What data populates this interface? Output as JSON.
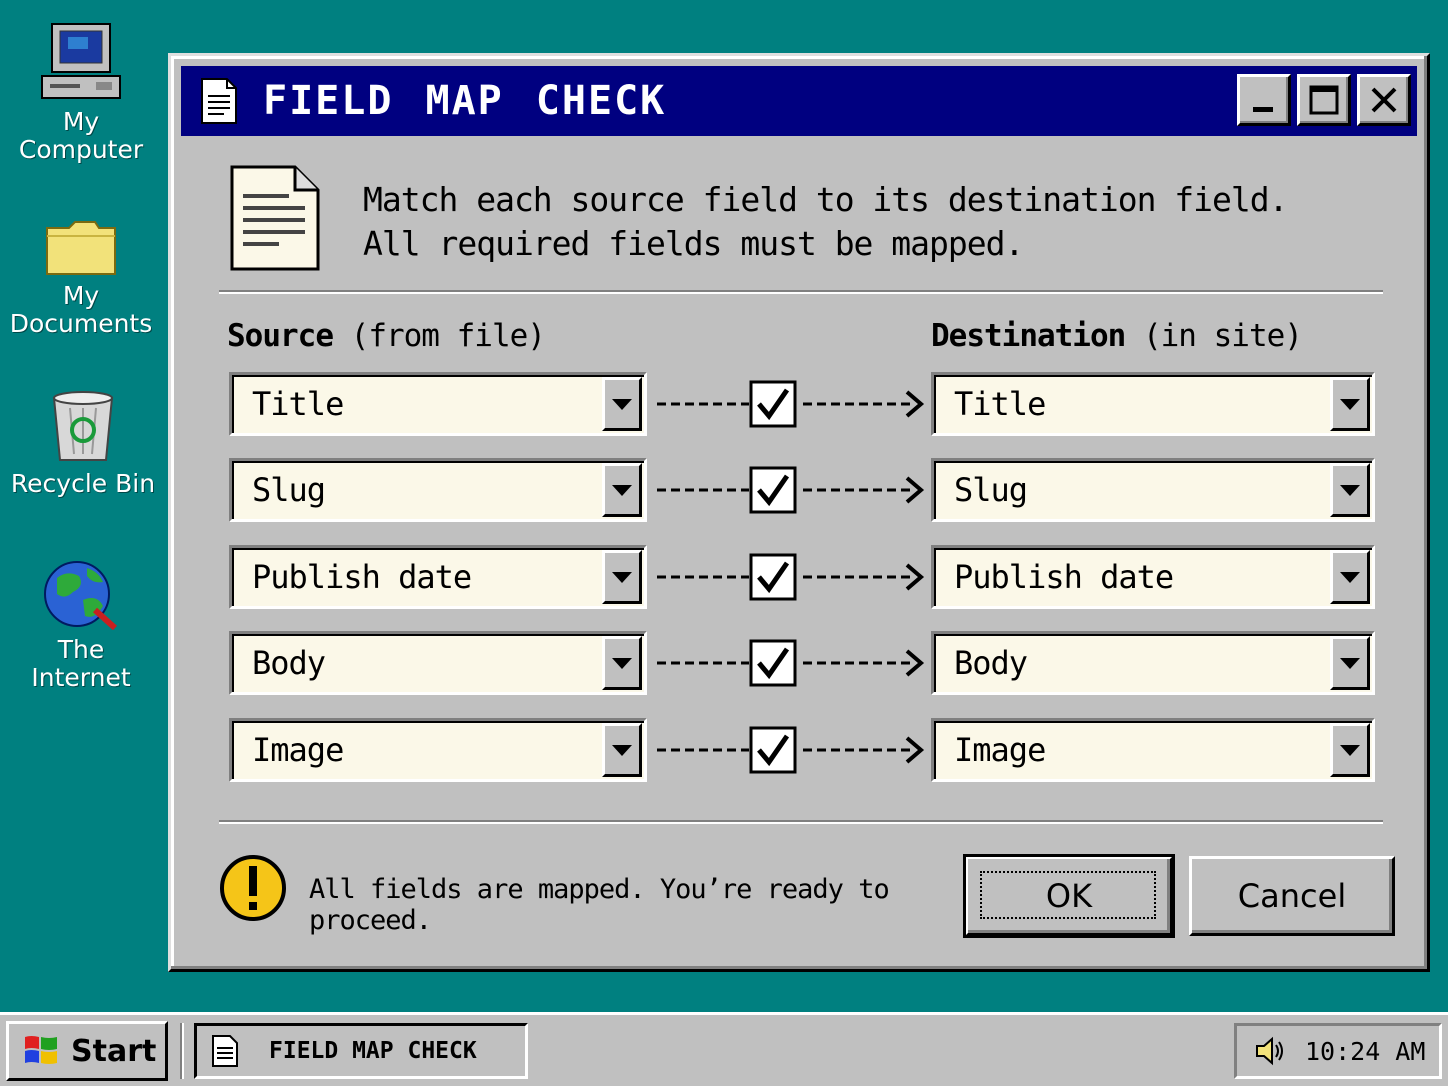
{
  "desktop": {
    "icons": [
      {
        "label_line1": "My",
        "label_line2": "Computer",
        "icon": "computer-icon"
      },
      {
        "label_line1": "My",
        "label_line2": "Documents",
        "icon": "folder-icon"
      },
      {
        "label_line1": "Recycle Bin",
        "label_line2": "",
        "icon": "recycle-bin-icon"
      },
      {
        "label_line1": "The",
        "label_line2": "Internet",
        "icon": "globe-icon"
      }
    ]
  },
  "window": {
    "title": "FIELD MAP CHECK",
    "instructions_line1": "Match each source field to its destination field.",
    "instructions_line2": "All required fields must be mapped.",
    "source_header_bold": "Source",
    "source_header_rest": "(from file)",
    "destination_header_bold": "Destination",
    "destination_header_rest": "(in site)",
    "mappings": [
      {
        "source": "Title",
        "destination": "Title",
        "checked": true
      },
      {
        "source": "Slug",
        "destination": "Slug",
        "checked": true
      },
      {
        "source": "Publish date",
        "destination": "Publish date",
        "checked": true
      },
      {
        "source": "Body",
        "destination": "Body",
        "checked": true
      },
      {
        "source": "Image",
        "destination": "Image",
        "checked": true
      }
    ],
    "status_text": "All fields are mapped. You’re ready to proceed.",
    "ok_label": "OK",
    "cancel_label": "Cancel"
  },
  "taskbar": {
    "start_label": "Start",
    "task_label": "FIELD MAP CHECK",
    "clock": "10:24 AM"
  },
  "colors": {
    "desktop": "#008080",
    "titlebar": "#000080",
    "face": "#c0c0c0",
    "field_bg": "#fbf8e8",
    "warning": "#f5c518"
  }
}
